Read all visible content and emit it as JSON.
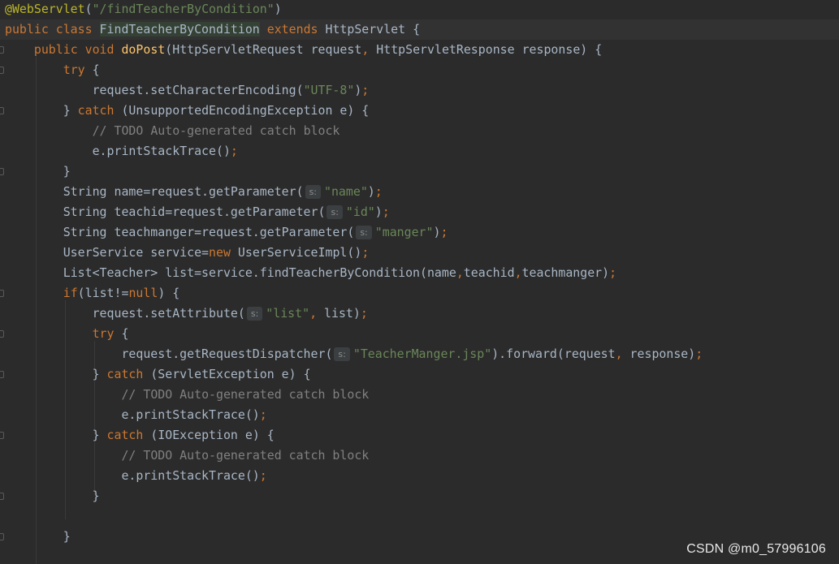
{
  "editor": {
    "lines": [
      {
        "tokens": [
          {
            "t": "@WebServlet",
            "c": "ann"
          },
          {
            "t": "(",
            "c": "plain"
          },
          {
            "t": "\"/findTeacherByCondition\"",
            "c": "str"
          },
          {
            "t": ")",
            "c": "plain"
          }
        ]
      },
      {
        "current": true,
        "tokens": [
          {
            "t": "public class ",
            "c": "kw"
          },
          {
            "t": "FindTeacherByCondition",
            "c": "hl"
          },
          {
            "t": " ",
            "c": "plain"
          },
          {
            "t": "extends ",
            "c": "kw"
          },
          {
            "t": "HttpServlet {",
            "c": "plain"
          }
        ]
      },
      {
        "tokens": [
          {
            "t": "    ",
            "c": "plain"
          },
          {
            "t": "public void ",
            "c": "kw"
          },
          {
            "t": "doPost",
            "c": "fn"
          },
          {
            "t": "(HttpServletRequest request",
            "c": "plain"
          },
          {
            "t": ", ",
            "c": "punct"
          },
          {
            "t": "HttpServletResponse response) {",
            "c": "plain"
          }
        ]
      },
      {
        "tokens": [
          {
            "t": "        ",
            "c": "plain"
          },
          {
            "t": "try ",
            "c": "kw"
          },
          {
            "t": "{",
            "c": "plain"
          }
        ]
      },
      {
        "tokens": [
          {
            "t": "            request.setCharacterEncoding(",
            "c": "plain"
          },
          {
            "t": "\"UTF-8\"",
            "c": "str"
          },
          {
            "t": ")",
            "c": "plain"
          },
          {
            "t": ";",
            "c": "punct"
          }
        ]
      },
      {
        "tokens": [
          {
            "t": "        } ",
            "c": "plain"
          },
          {
            "t": "catch ",
            "c": "kw"
          },
          {
            "t": "(UnsupportedEncodingException e) {",
            "c": "plain"
          }
        ]
      },
      {
        "tokens": [
          {
            "t": "            ",
            "c": "plain"
          },
          {
            "t": "// TODO Auto-generated catch block",
            "c": "cmt"
          }
        ]
      },
      {
        "tokens": [
          {
            "t": "            e.printStackTrace()",
            "c": "plain"
          },
          {
            "t": ";",
            "c": "punct"
          }
        ]
      },
      {
        "tokens": [
          {
            "t": "        }",
            "c": "plain"
          }
        ]
      },
      {
        "tokens": [
          {
            "t": "        String name=request.getParameter(",
            "c": "plain"
          },
          {
            "t": "s:",
            "c": "hint"
          },
          {
            "t": "\"name\"",
            "c": "str"
          },
          {
            "t": ")",
            "c": "plain"
          },
          {
            "t": ";",
            "c": "punct"
          }
        ]
      },
      {
        "tokens": [
          {
            "t": "        String teachid=request.getParameter(",
            "c": "plain"
          },
          {
            "t": "s:",
            "c": "hint"
          },
          {
            "t": "\"id\"",
            "c": "str"
          },
          {
            "t": ")",
            "c": "plain"
          },
          {
            "t": ";",
            "c": "punct"
          }
        ]
      },
      {
        "tokens": [
          {
            "t": "        String teachmanger=request.getParameter(",
            "c": "plain"
          },
          {
            "t": "s:",
            "c": "hint"
          },
          {
            "t": "\"manger\"",
            "c": "str"
          },
          {
            "t": ")",
            "c": "plain"
          },
          {
            "t": ";",
            "c": "punct"
          }
        ]
      },
      {
        "tokens": [
          {
            "t": "        UserService service=",
            "c": "plain"
          },
          {
            "t": "new ",
            "c": "kw"
          },
          {
            "t": "UserServiceImpl()",
            "c": "plain"
          },
          {
            "t": ";",
            "c": "punct"
          }
        ]
      },
      {
        "tokens": [
          {
            "t": "        List<Teacher> list=service.findTeacherByCondition(name",
            "c": "plain"
          },
          {
            "t": ",",
            "c": "punct"
          },
          {
            "t": "teachid",
            "c": "plain"
          },
          {
            "t": ",",
            "c": "punct"
          },
          {
            "t": "teachmanger)",
            "c": "plain"
          },
          {
            "t": ";",
            "c": "punct"
          }
        ]
      },
      {
        "tokens": [
          {
            "t": "        ",
            "c": "plain"
          },
          {
            "t": "if",
            "c": "kw"
          },
          {
            "t": "(list!=",
            "c": "plain"
          },
          {
            "t": "null",
            "c": "kw"
          },
          {
            "t": ") {",
            "c": "plain"
          }
        ]
      },
      {
        "tokens": [
          {
            "t": "            request.setAttribute(",
            "c": "plain"
          },
          {
            "t": "s:",
            "c": "hint"
          },
          {
            "t": "\"list\"",
            "c": "str"
          },
          {
            "t": ", ",
            "c": "punct"
          },
          {
            "t": "list)",
            "c": "plain"
          },
          {
            "t": ";",
            "c": "punct"
          }
        ]
      },
      {
        "tokens": [
          {
            "t": "            ",
            "c": "plain"
          },
          {
            "t": "try ",
            "c": "kw"
          },
          {
            "t": "{",
            "c": "plain"
          }
        ]
      },
      {
        "tokens": [
          {
            "t": "                request.getRequestDispatcher(",
            "c": "plain"
          },
          {
            "t": "s:",
            "c": "hint"
          },
          {
            "t": "\"TeacherManger.jsp\"",
            "c": "str"
          },
          {
            "t": ").forward(request",
            "c": "plain"
          },
          {
            "t": ", ",
            "c": "punct"
          },
          {
            "t": "response)",
            "c": "plain"
          },
          {
            "t": ";",
            "c": "punct"
          }
        ]
      },
      {
        "tokens": [
          {
            "t": "            } ",
            "c": "plain"
          },
          {
            "t": "catch ",
            "c": "kw"
          },
          {
            "t": "(ServletException e) {",
            "c": "plain"
          }
        ]
      },
      {
        "tokens": [
          {
            "t": "                ",
            "c": "plain"
          },
          {
            "t": "// TODO Auto-generated catch block",
            "c": "cmt"
          }
        ]
      },
      {
        "tokens": [
          {
            "t": "                e.printStackTrace()",
            "c": "plain"
          },
          {
            "t": ";",
            "c": "punct"
          }
        ]
      },
      {
        "tokens": [
          {
            "t": "            } ",
            "c": "plain"
          },
          {
            "t": "catch ",
            "c": "kw"
          },
          {
            "t": "(IOException e) {",
            "c": "plain"
          }
        ]
      },
      {
        "tokens": [
          {
            "t": "                ",
            "c": "plain"
          },
          {
            "t": "// TODO Auto-generated catch block",
            "c": "cmt"
          }
        ]
      },
      {
        "tokens": [
          {
            "t": "                e.printStackTrace()",
            "c": "plain"
          },
          {
            "t": ";",
            "c": "punct"
          }
        ]
      },
      {
        "tokens": [
          {
            "t": "            }",
            "c": "plain"
          }
        ]
      },
      {
        "tokens": [
          {
            "t": "",
            "c": "plain"
          }
        ]
      },
      {
        "tokens": [
          {
            "t": "        }",
            "c": "plain"
          }
        ]
      }
    ]
  },
  "watermark": {
    "text": "CSDN @m0_57996106"
  },
  "colors": {
    "background": "#2b2b2b",
    "current_line": "#323232",
    "keyword": "#cc7832",
    "string": "#6a8759",
    "comment": "#808080",
    "annotation": "#bbb529",
    "method_declaration": "#ffc66d",
    "plain": "#a9b7c6"
  }
}
